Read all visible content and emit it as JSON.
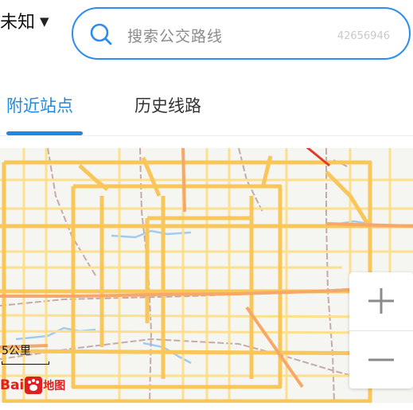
{
  "header": {
    "city": "未知",
    "search_placeholder": "搜索公交路线",
    "search_code": "42656946"
  },
  "tabs": [
    {
      "label": "附近站点",
      "active": true
    },
    {
      "label": "历史线路",
      "active": false
    }
  ],
  "map": {
    "scale_label": "5公里",
    "logo_latin": "Bai",
    "logo_cn": "地图",
    "icons": {
      "zoom_in": "plus-icon",
      "zoom_out": "minus-icon",
      "search": "search-icon",
      "dropdown": "caret-down-icon",
      "logo_paw": "baidu-paw-icon"
    }
  },
  "colors": {
    "accent": "#1e88e5",
    "search_border": "#2d8cf0",
    "road_major": "#f9c65a",
    "road_minor": "#fde08e",
    "road_arterial": "#f7a868",
    "rail": "#c6aaa8",
    "water": "#9fcdf2",
    "annotation_arrow": "#e03b2a"
  }
}
